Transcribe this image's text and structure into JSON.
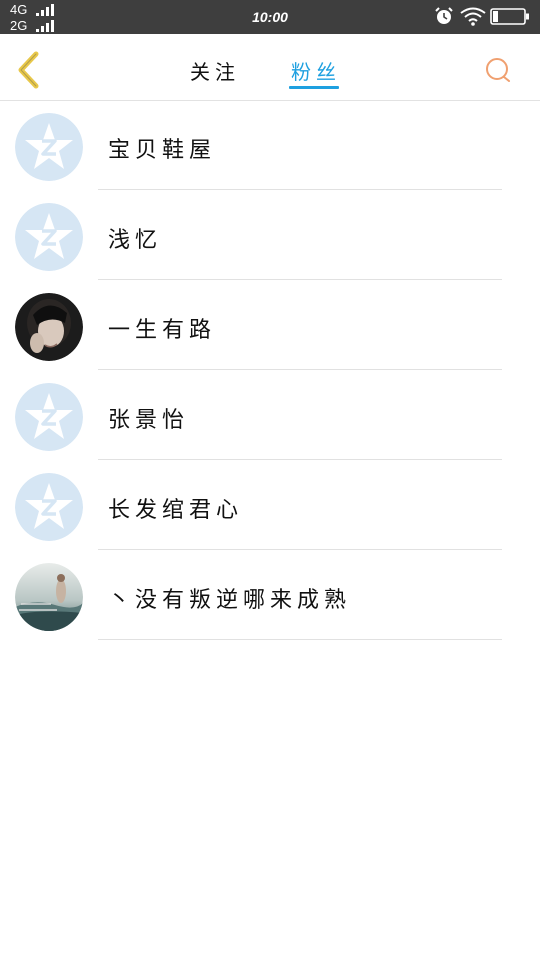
{
  "status_bar": {
    "network_1": "4G",
    "network_2": "2G",
    "time": "10:00"
  },
  "header": {
    "tabs": [
      {
        "label": "关注",
        "active": false
      },
      {
        "label": "粉丝",
        "active": true
      }
    ]
  },
  "colors": {
    "accent": "#1ea0e0",
    "status_bar_bg": "#3e3e3e",
    "back_icon": "#e8c84a",
    "search_icon": "#f0a070",
    "default_avatar": "#d6e6f4"
  },
  "icons": {
    "back": "chevron-left-icon",
    "search": "search-icon",
    "alarm": "alarm-icon",
    "wifi": "wifi-icon",
    "battery": "battery-icon"
  },
  "fans": [
    {
      "name": "宝贝鞋屋",
      "avatar": "default-qq-avatar"
    },
    {
      "name": "浅忆",
      "avatar": "default-qq-avatar"
    },
    {
      "name": "一生有路",
      "avatar": "photo-avatar-person"
    },
    {
      "name": "张景怡",
      "avatar": "default-qq-avatar"
    },
    {
      "name": "长发绾君心",
      "avatar": "default-qq-avatar"
    },
    {
      "name": "丶没有叛逆哪来成熟",
      "avatar": "photo-avatar-scene"
    }
  ]
}
